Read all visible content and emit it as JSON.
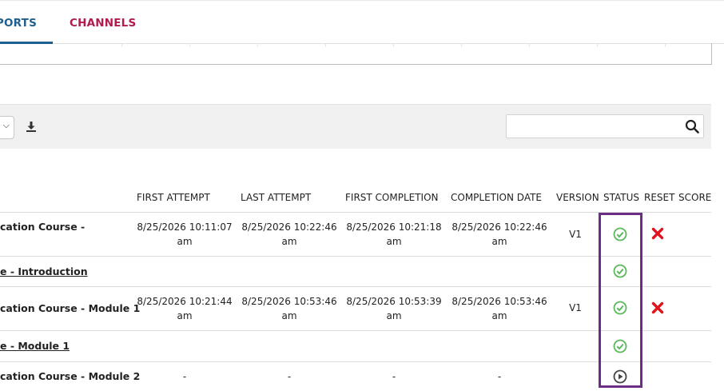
{
  "tabs": [
    {
      "label": "PORTS",
      "active": true
    },
    {
      "label": "CHANNELS",
      "active": false
    }
  ],
  "search": {
    "placeholder": "",
    "value": ""
  },
  "table": {
    "headers": [
      "FIRST ATTEMPT",
      "LAST ATTEMPT",
      "FIRST COMPLETION",
      "COMPLETION DATE",
      "VERSION",
      "STATUS",
      "RESET",
      "SCORE"
    ],
    "rows": [
      {
        "title": "cation Course -",
        "type": "course",
        "first_attempt": [
          "8/25/2026 10:11:07",
          "am"
        ],
        "last_attempt": [
          "8/25/2026 10:22:46",
          "am"
        ],
        "first_completion": [
          "8/25/2026 10:21:18",
          "am"
        ],
        "completion_date": [
          "8/25/2026 10:22:46",
          "am"
        ],
        "version": "V1",
        "status": "completed",
        "reset": true
      },
      {
        "title": "e - Introduction",
        "type": "module",
        "status": "completed",
        "reset": false
      },
      {
        "title": "cation Course - Module 1",
        "type": "course",
        "first_attempt": [
          "8/25/2026 10:21:44",
          "am"
        ],
        "last_attempt": [
          "8/25/2026 10:53:46",
          "am"
        ],
        "first_completion": [
          "8/25/2026 10:53:39",
          "am"
        ],
        "completion_date": [
          "8/25/2026 10:53:46",
          "am"
        ],
        "version": "V1",
        "status": "completed",
        "reset": true
      },
      {
        "title": "e - Module 1",
        "type": "module",
        "status": "completed",
        "reset": false
      },
      {
        "title": "cation Course - Module 2",
        "type": "course",
        "first_attempt": [
          "-"
        ],
        "last_attempt": [
          "-"
        ],
        "first_completion": [
          "-"
        ],
        "completion_date": [
          "-"
        ],
        "version": "",
        "status": "in-progress",
        "reset": false
      }
    ]
  },
  "colors": {
    "accent": "#1f5f8f",
    "channels": "#b31b4e",
    "success": "#5cb85c",
    "reset": "#e0141e",
    "highlight": "#6b2d86"
  }
}
